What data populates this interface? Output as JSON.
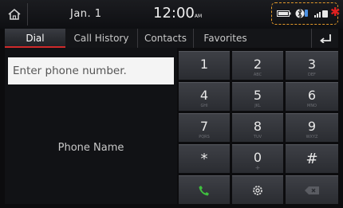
{
  "status_bar": {
    "date": "Jan.  1",
    "time": "12:00",
    "ampm": "AM",
    "icons": [
      "home-icon",
      "battery-icon",
      "bluetooth-phone-icon",
      "signal-icon",
      "recording-dot-icon"
    ]
  },
  "tabs": [
    {
      "label": "Dial",
      "active": true
    },
    {
      "label": "Call History",
      "active": false
    },
    {
      "label": "Contacts",
      "active": false
    },
    {
      "label": "Favorites",
      "active": false
    }
  ],
  "dial": {
    "placeholder": "Enter phone number.",
    "phone_name": "Phone Name"
  },
  "keypad": [
    {
      "digit": "1",
      "letters": ""
    },
    {
      "digit": "2",
      "letters": "ABC"
    },
    {
      "digit": "3",
      "letters": "DEF"
    },
    {
      "digit": "4",
      "letters": "GHI"
    },
    {
      "digit": "5",
      "letters": "JKL"
    },
    {
      "digit": "6",
      "letters": "MNO"
    },
    {
      "digit": "7",
      "letters": "PQRS"
    },
    {
      "digit": "8",
      "letters": "TUV"
    },
    {
      "digit": "9",
      "letters": "WXYZ"
    },
    {
      "digit": "*",
      "letters": ""
    },
    {
      "digit": "0",
      "letters": "+"
    },
    {
      "digit": "#",
      "letters": ""
    }
  ],
  "colors": {
    "accent_red": "#d02a2a",
    "call_green": "#3fbf3f",
    "highlight_orange": "#e39a2a"
  }
}
